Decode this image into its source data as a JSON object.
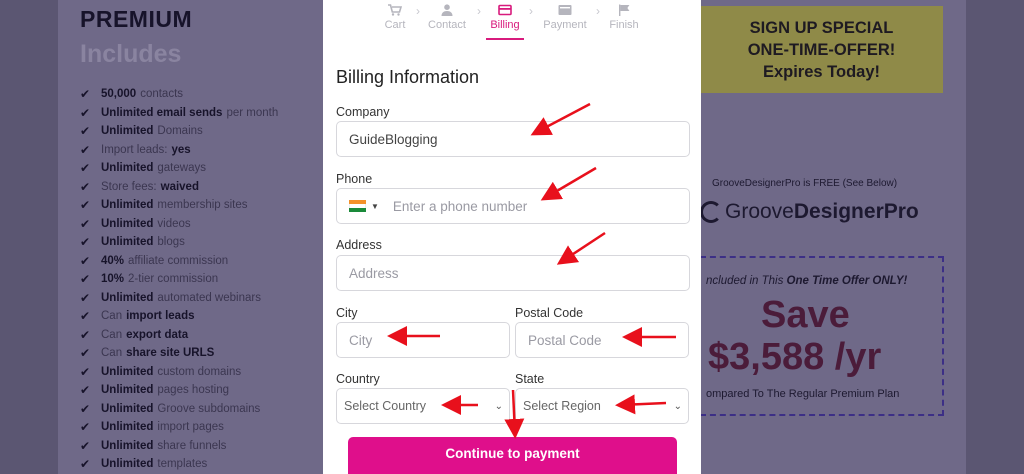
{
  "background": {
    "premium_title": "PREMIUM",
    "premium_subtitle": "Includes",
    "features": [
      {
        "bold": "50,000",
        "text": "contacts",
        "bold_after": ""
      },
      {
        "bold": "Unlimited email sends",
        "text": "per month",
        "bold_after": ""
      },
      {
        "bold": "Unlimited",
        "text": "Domains",
        "bold_after": ""
      },
      {
        "bold": "",
        "text": "Import leads:",
        "bold_after": "yes"
      },
      {
        "bold": "Unlimited",
        "text": "gateways",
        "bold_after": ""
      },
      {
        "bold": "",
        "text": "Store fees:",
        "bold_after": "waived"
      },
      {
        "bold": "Unlimited",
        "text": "membership sites",
        "bold_after": ""
      },
      {
        "bold": "Unlimited",
        "text": "videos",
        "bold_after": ""
      },
      {
        "bold": "Unlimited",
        "text": "blogs",
        "bold_after": ""
      },
      {
        "bold": "40%",
        "text": "affiliate commission",
        "bold_after": ""
      },
      {
        "bold": "10%",
        "text": "2-tier commission",
        "bold_after": ""
      },
      {
        "bold": "Unlimited",
        "text": "automated webinars",
        "bold_after": ""
      },
      {
        "bold": "",
        "text": "Can",
        "bold_after": "import leads"
      },
      {
        "bold": "",
        "text": "Can",
        "bold_after": "export data"
      },
      {
        "bold": "",
        "text": "Can",
        "bold_after": "share site URLS"
      },
      {
        "bold": "Unlimited",
        "text": "custom domains",
        "bold_after": ""
      },
      {
        "bold": "Unlimited",
        "text": "pages hosting",
        "bold_after": ""
      },
      {
        "bold": "Unlimited",
        "text": "Groove subdomains",
        "bold_after": ""
      },
      {
        "bold": "Unlimited",
        "text": "import pages",
        "bold_after": ""
      },
      {
        "bold": "Unlimited",
        "text": "share funnels",
        "bold_after": ""
      },
      {
        "bold": "Unlimited",
        "text": "templates",
        "bold_after": ""
      }
    ],
    "offer": {
      "line1": "SIGN UP SPECIAL",
      "line2": "ONE-TIME-OFFER!",
      "line3": "Expires Today!"
    },
    "gdp_free": "GrooveDesignerPro is FREE (See Below)",
    "gdp_logo_light": "Groove",
    "gdp_logo_bold": "DesignerPro",
    "save_included_prefix": "ncluded in This ",
    "save_included_bold": "One Time Offer ONLY!",
    "save_big": "Save",
    "save_amount": "$3,588 /yr",
    "save_compare": "ompared To The Regular Premium Plan"
  },
  "steps": [
    {
      "label": "Cart",
      "icon": "cart-icon",
      "active": false
    },
    {
      "label": "Contact",
      "icon": "user-icon",
      "active": false
    },
    {
      "label": "Billing",
      "icon": "credit-card-icon",
      "active": true
    },
    {
      "label": "Payment",
      "icon": "payment-icon",
      "active": false
    },
    {
      "label": "Finish",
      "icon": "flag-icon",
      "active": false
    }
  ],
  "form": {
    "title": "Billing Information",
    "company_label": "Company",
    "company_value": "GuideBlogging",
    "phone_label": "Phone",
    "phone_placeholder": "Enter a phone number",
    "address_label": "Address",
    "address_placeholder": "Address",
    "city_label": "City",
    "city_placeholder": "City",
    "postal_label": "Postal Code",
    "postal_placeholder": "Postal Code",
    "country_label": "Country",
    "country_selected": "Select Country",
    "state_label": "State",
    "state_selected": "Select Region",
    "submit_label": "Continue to payment"
  },
  "colors": {
    "accent": "#df0f8b",
    "active_step": "#d81b7d",
    "annotation_arrow": "#e8101c"
  }
}
